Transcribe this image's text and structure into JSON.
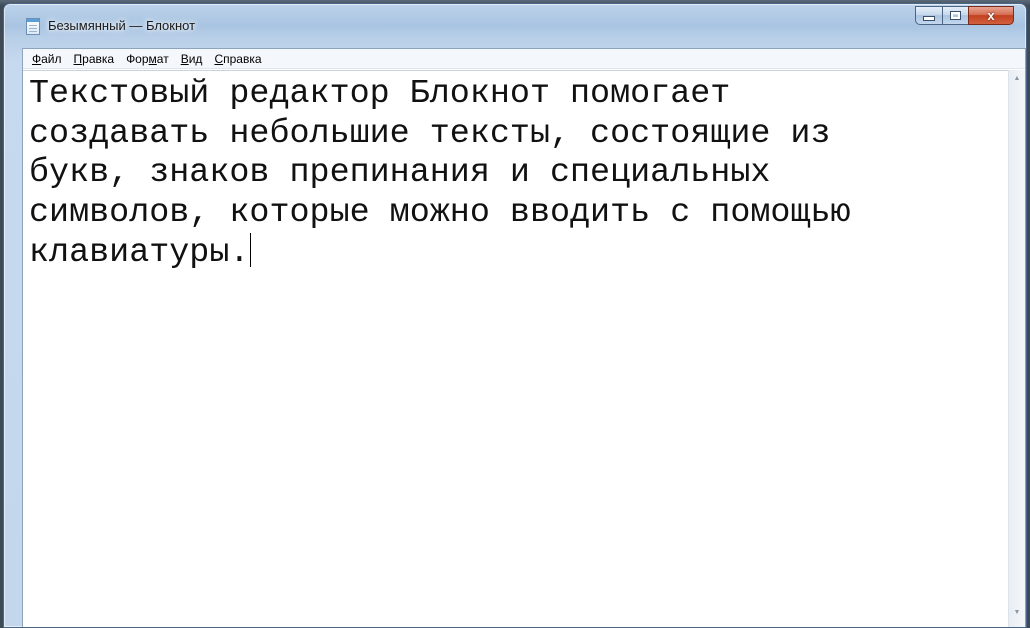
{
  "window": {
    "title": "Безымянный — Блокнот",
    "controls": {
      "minimize_icon": "minimize-icon",
      "maximize_icon": "maximize-icon",
      "close_glyph": "x"
    }
  },
  "menu": {
    "items": [
      {
        "mnemonic": "Ф",
        "rest": "айл"
      },
      {
        "mnemonic": "П",
        "rest": "равка"
      },
      {
        "pre": "Фор",
        "mnemonic": "м",
        "rest": "ат"
      },
      {
        "mnemonic": "В",
        "rest": "ид"
      },
      {
        "mnemonic": "С",
        "rest": "правка"
      }
    ]
  },
  "editor": {
    "lines": [
      "Текстовый редактор Блокнот помогает",
      "создавать небольшие тексты, состоящие из",
      "букв, знаков препинания и специальных",
      "символов, которые можно вводить с помощью",
      "клавиатуры."
    ]
  },
  "scrollbar": {
    "up_icon": "scroll-up-arrow-icon",
    "down_icon": "scroll-down-arrow-icon"
  }
}
